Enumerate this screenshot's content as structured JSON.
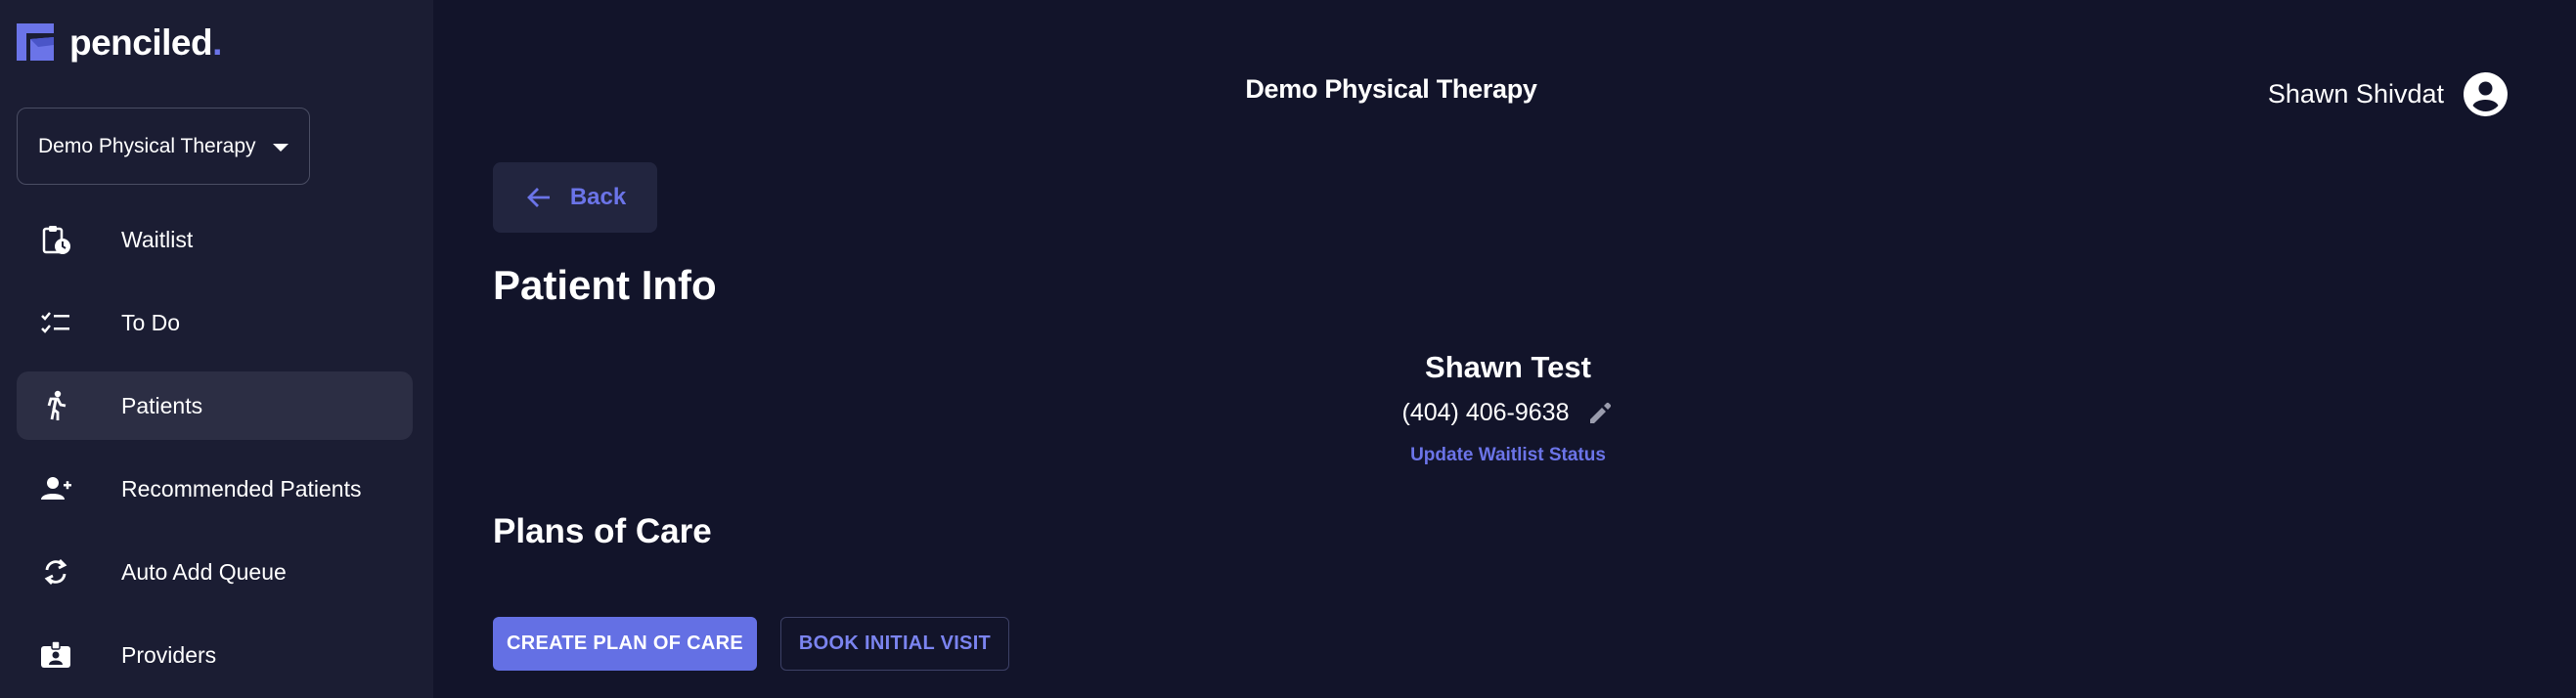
{
  "brand": {
    "name": "penciled",
    "dot": ".",
    "accent": "#6b74e8"
  },
  "sidebar": {
    "practice_select": {
      "value": "Demo Physical Therapy"
    },
    "items": [
      {
        "label": "Waitlist",
        "icon": "clipboard-clock-icon",
        "active": false
      },
      {
        "label": "To Do",
        "icon": "checklist-icon",
        "active": false
      },
      {
        "label": "Patients",
        "icon": "running-person-icon",
        "active": true
      },
      {
        "label": "Recommended Patients",
        "icon": "person-add-icon",
        "active": false
      },
      {
        "label": "Auto Add Queue",
        "icon": "sync-icon",
        "active": false
      },
      {
        "label": "Providers",
        "icon": "badge-icon",
        "active": false
      }
    ]
  },
  "header": {
    "title": "Demo Physical Therapy",
    "user_name": "Shawn Shivdat"
  },
  "main": {
    "back_label": "Back",
    "page_title": "Patient Info",
    "patient": {
      "name": "Shawn Test",
      "phone": "(404) 406-9638",
      "update_status_label": "Update Waitlist Status"
    },
    "plans_title": "Plans of Care",
    "create_plan_label": "CREATE PLAN OF CARE",
    "book_visit_label": "BOOK INITIAL VISIT"
  },
  "colors": {
    "background": "#12142a",
    "sidebar": "#1b1d33",
    "active_item": "#2c2e44",
    "primary_button": "#6470e4"
  }
}
